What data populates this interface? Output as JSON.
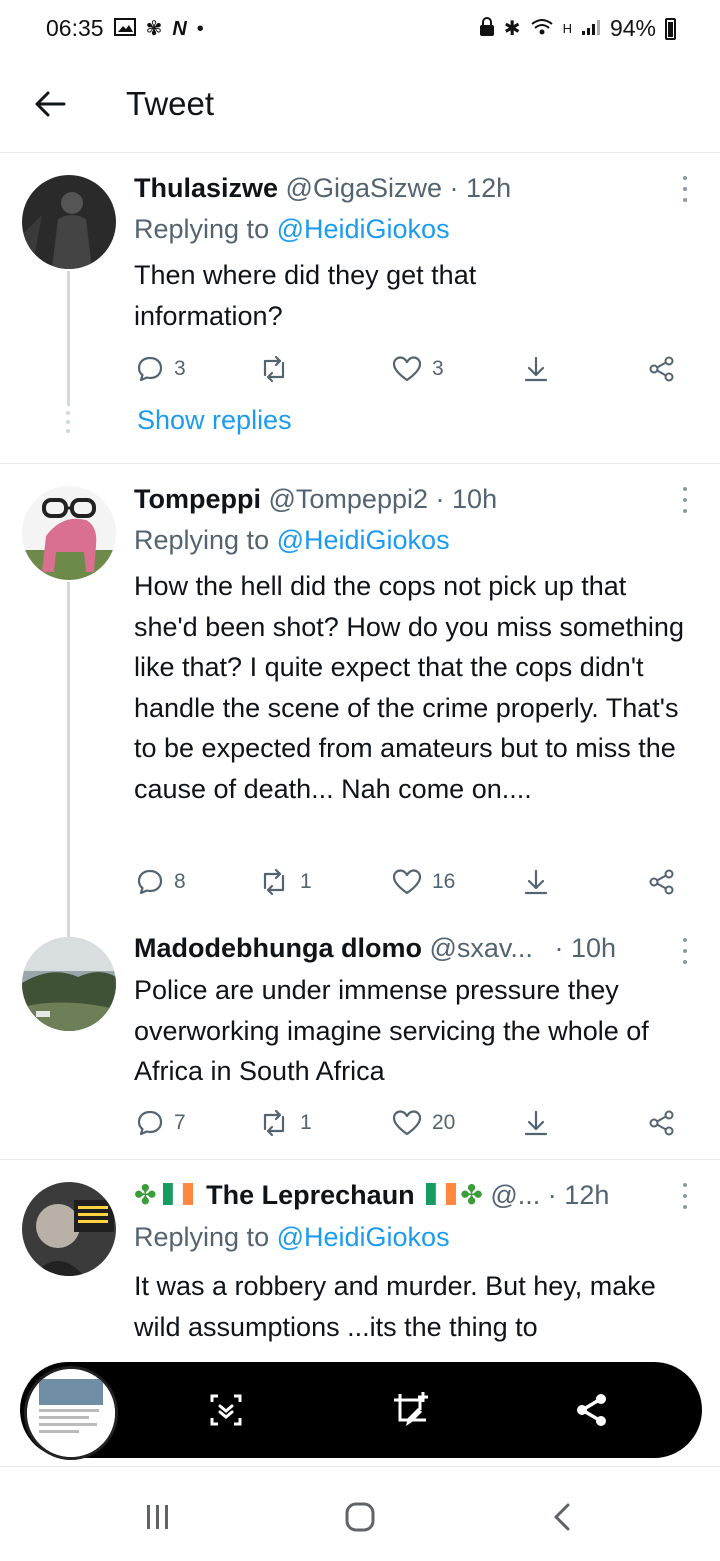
{
  "status_bar": {
    "time": "06:35",
    "battery": "94%",
    "net_label": "H"
  },
  "header": {
    "title": "Tweet"
  },
  "tweets": [
    {
      "name": "Thulasizwe",
      "handle": "@GigaSizwe",
      "time": "12h",
      "replying_prefix": "Replying to ",
      "replying_to": "@HeidiGiokos",
      "text": "Then where did they get that information?",
      "replies": "3",
      "retweets": "",
      "likes": "3",
      "show_replies": "Show replies"
    },
    {
      "name": "Tompeppi",
      "handle": "@Tompeppi2",
      "time": "10h",
      "replying_prefix": "Replying to ",
      "replying_to": "@HeidiGiokos",
      "text": "How the hell did the cops not pick up that she'd been shot? How do you miss something like that? I quite expect that the cops didn't handle the scene of the crime properly. That's to be expected from amateurs but to miss the cause of death... Nah come on....",
      "replies": "8",
      "retweets": "1",
      "likes": "16"
    },
    {
      "name": "Madodebhunga dlomo",
      "handle": "@sxav...",
      "time": "10h",
      "text": "Police are under immense pressure they overworking imagine servicing the whole of Africa in South Africa",
      "replies": "7",
      "retweets": "1",
      "likes": "20"
    },
    {
      "name": "The Leprechaun",
      "handle": "@...",
      "time": "12h",
      "replying_prefix": "Replying to ",
      "replying_to": "@HeidiGiokos",
      "text": "It was a robbery and murder. But hey, make wild assumptions ...its the thing to"
    }
  ],
  "colors": {
    "link": "#1d9bf0",
    "secondary_text": "#536471",
    "divider": "#e6ecf0",
    "toolbar": "#000000"
  },
  "icons": {
    "reply": "speech-bubble-icon",
    "retweet": "retweet-icon",
    "like": "heart-icon",
    "bookmark": "download-arrow-icon",
    "share": "share-icon"
  }
}
